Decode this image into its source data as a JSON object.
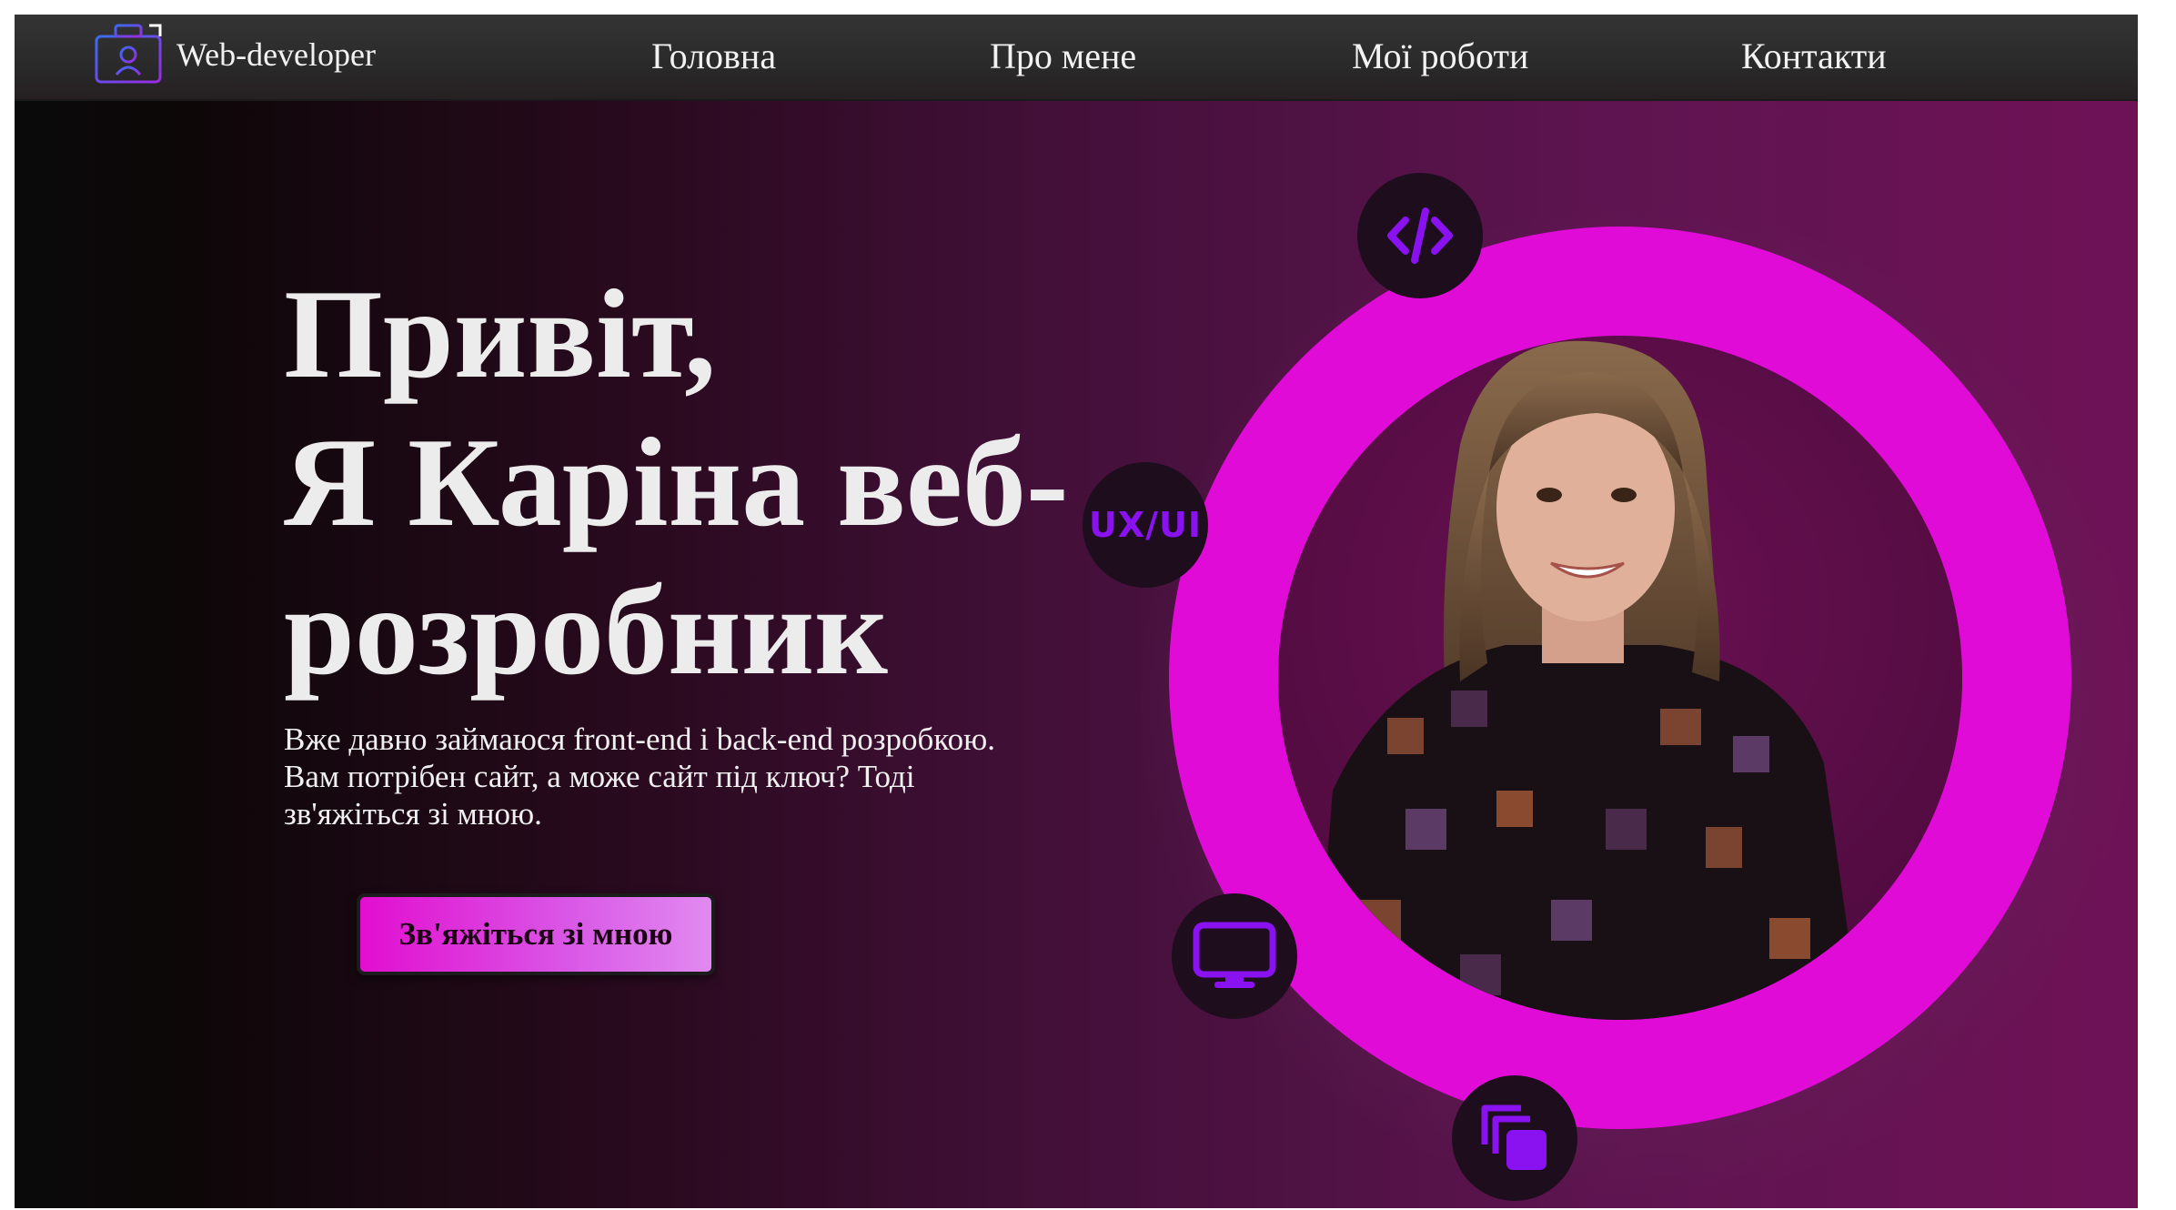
{
  "brand": {
    "name": "Web-developer",
    "logo_icon": "briefcase-user-icon"
  },
  "nav": {
    "items": [
      {
        "label": "Головна"
      },
      {
        "label": "Про мене"
      },
      {
        "label": "Мої роботи"
      },
      {
        "label": "Контакти"
      }
    ]
  },
  "hero": {
    "title_line1": "Привіт,",
    "title_line2": "Я Каріна веб-",
    "title_line3": "розробник",
    "description_line1": "Вже давно займаюся front-end і back-end розробкою.",
    "description_line2": "Вам потрібен сайт, а може сайт під ключ? Тоді",
    "description_line3": "зв'яжіться зі мною.",
    "cta_label": "Зв'яжіться зі мною"
  },
  "badges": [
    {
      "icon": "code-icon"
    },
    {
      "icon": "ux-ui-text-icon",
      "text": "UX/UI"
    },
    {
      "icon": "monitor-icon"
    },
    {
      "icon": "layers-copy-icon"
    }
  ],
  "colors": {
    "accent_ring": "#e10bd8",
    "badge_icon": "#8a11f0",
    "badge_bg": "#1d0d1d",
    "nav_bg": "#2e2e2e"
  }
}
